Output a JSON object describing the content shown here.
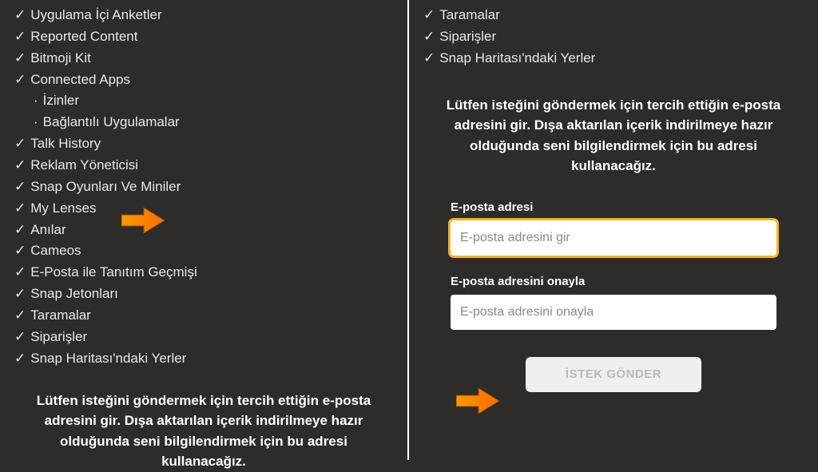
{
  "left": {
    "items": [
      {
        "type": "check",
        "label": "Uygulama İçi Anketler"
      },
      {
        "type": "check",
        "label": "Reported Content"
      },
      {
        "type": "check",
        "label": "Bitmoji Kit"
      },
      {
        "type": "check",
        "label": "Connected Apps"
      },
      {
        "type": "sub",
        "label": "İzinler"
      },
      {
        "type": "sub",
        "label": "Bağlantılı Uygulamalar"
      },
      {
        "type": "check",
        "label": "Talk History"
      },
      {
        "type": "check",
        "label": "Reklam Yöneticisi"
      },
      {
        "type": "check",
        "label": "Snap Oyunları Ve Miniler"
      },
      {
        "type": "check",
        "label": "My Lenses"
      },
      {
        "type": "check",
        "label": "Anılar"
      },
      {
        "type": "check",
        "label": "Cameos"
      },
      {
        "type": "check",
        "label": "E-Posta ile Tanıtım Geçmişi"
      },
      {
        "type": "check",
        "label": "Snap Jetonları"
      },
      {
        "type": "check",
        "label": "Taramalar"
      },
      {
        "type": "check",
        "label": "Siparişler"
      },
      {
        "type": "check",
        "label": "Snap Haritası'ndaki Yerler"
      }
    ],
    "instruction": "Lütfen isteğini göndermek için tercih ettiğin e-posta adresini gir. Dışa aktarılan içerik indirilmeye hazır olduğunda seni bilgilendirmek için bu adresi kullanacağız."
  },
  "right": {
    "items": [
      {
        "type": "check",
        "label": "Taramalar"
      },
      {
        "type": "check",
        "label": "Siparişler"
      },
      {
        "type": "check",
        "label": "Snap Haritası'ndaki Yerler"
      }
    ],
    "instruction": "Lütfen isteğini göndermek için tercih ettiğin e-posta adresini gir. Dışa aktarılan içerik indirilmeye hazır olduğunda seni bilgilendirmek için bu adresi kullanacağız.",
    "email_label": "E-posta adresi",
    "email_placeholder": "E-posta adresini gir",
    "confirm_label": "E-posta adresini onayla",
    "confirm_placeholder": "E-posta adresini onayla",
    "submit_label": "İSTEK GÖNDER"
  },
  "icons": {
    "check": "✓",
    "dot": "·"
  }
}
